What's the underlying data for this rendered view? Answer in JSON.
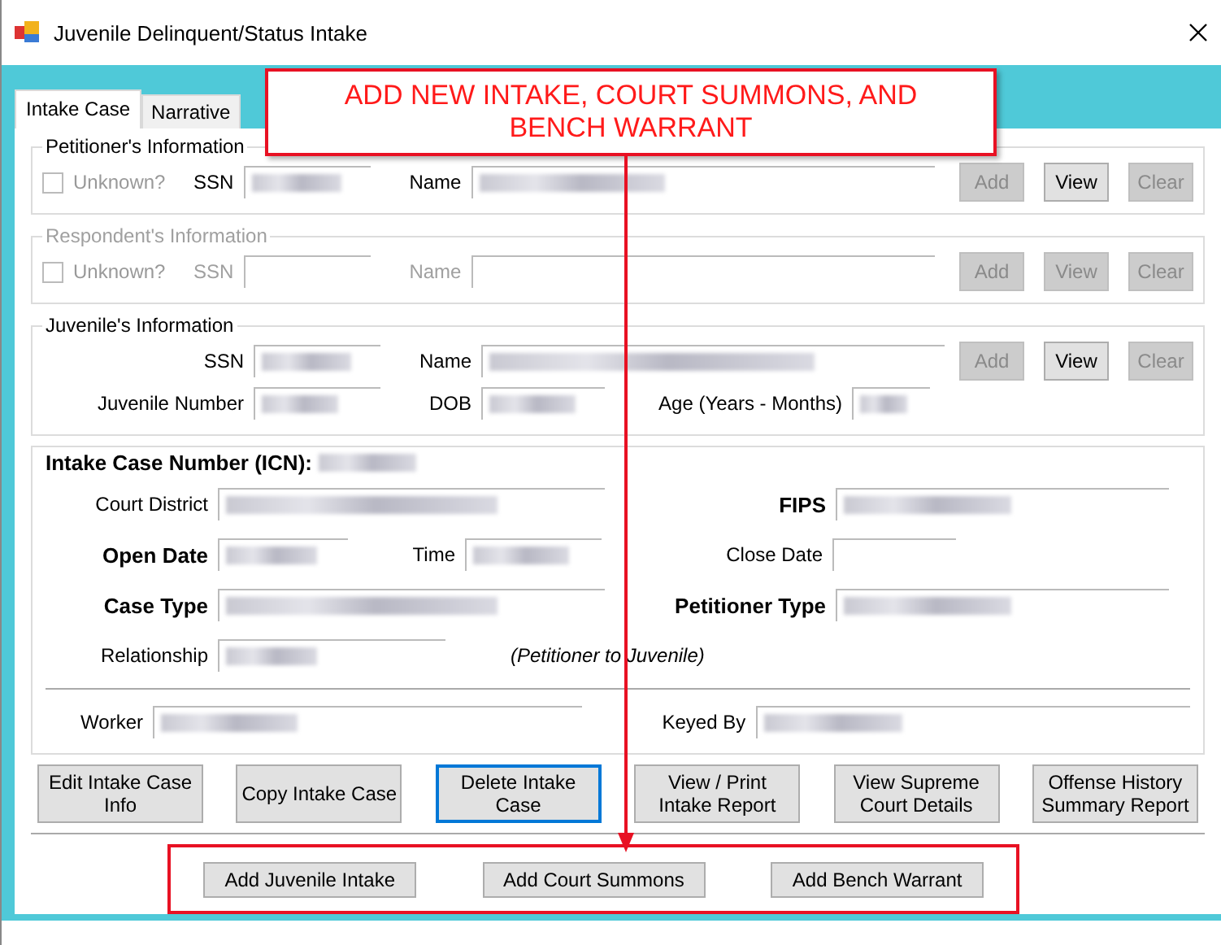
{
  "window": {
    "title": "Juvenile Delinquent/Status Intake"
  },
  "tabs": [
    {
      "label": "Intake Case",
      "selected": true
    },
    {
      "label": "Narrative",
      "selected": false
    }
  ],
  "parties": [
    {
      "title": "Petitioner's Information",
      "disabled": false,
      "unknown": {
        "label": "Unknown?",
        "checked": false
      },
      "ssn_label": "SSN",
      "name_label": "Name",
      "redacted": true,
      "buttons": [
        {
          "label": "Add",
          "disabled": true
        },
        {
          "label": "View",
          "disabled": false
        },
        {
          "label": "Clear",
          "disabled": true
        }
      ]
    },
    {
      "title": "Respondent's Information",
      "disabled": true,
      "unknown": {
        "label": "Unknown?",
        "checked": false
      },
      "ssn_label": "SSN",
      "name_label": "Name",
      "redacted": false,
      "buttons": [
        {
          "label": "Add",
          "disabled": true
        },
        {
          "label": "View",
          "disabled": true
        },
        {
          "label": "Clear",
          "disabled": true
        }
      ]
    }
  ],
  "juvenile": {
    "title": "Juvenile's Information",
    "ssn_label": "SSN",
    "name_label": "Name",
    "number_label": "Juvenile Number",
    "dob_label": "DOB",
    "age_label": "Age (Years - Months)",
    "buttons": [
      {
        "label": "Add",
        "disabled": true
      },
      {
        "label": "View",
        "disabled": false
      },
      {
        "label": "Clear",
        "disabled": true
      }
    ]
  },
  "case": {
    "heading": "Intake Case Number (ICN):",
    "rows": [
      {
        "kind": "pair",
        "left": {
          "label": "Court District",
          "bold": false,
          "redacted": true
        },
        "right": {
          "label": "FIPS",
          "bold": true,
          "redacted": true
        }
      },
      {
        "kind": "date",
        "left": {
          "label": "Open Date",
          "bold": true,
          "redacted": true
        },
        "middle": {
          "label": "Time",
          "bold": false,
          "redacted": true
        },
        "right": {
          "label": "Close Date",
          "bold": false,
          "redacted": false
        }
      },
      {
        "kind": "pair",
        "left": {
          "label": "Case Type",
          "bold": true,
          "redacted": true
        },
        "right": {
          "label": "Petitioner Type",
          "bold": true,
          "redacted": true
        }
      },
      {
        "kind": "note",
        "left": {
          "label": "Relationship",
          "bold": false,
          "redacted": true
        },
        "note": "(Petitioner to Juvenile)"
      }
    ],
    "footer": {
      "left": {
        "label": "Worker",
        "bold": false,
        "redacted": true
      },
      "right": {
        "label": "Keyed By",
        "bold": false,
        "redacted": true
      }
    }
  },
  "actions": [
    {
      "label": "Edit Intake Case Info",
      "focused": false
    },
    {
      "label": "Copy Intake Case",
      "focused": false
    },
    {
      "label": "Delete Intake Case",
      "focused": true
    },
    {
      "label": "View / Print Intake Report",
      "focused": false
    },
    {
      "label": "View Supreme Court Details",
      "focused": false
    },
    {
      "label": "Offense History Summary Report",
      "focused": false
    }
  ],
  "add_buttons": [
    "Add Juvenile Intake",
    "Add Court Summons",
    "Add Bench Warrant"
  ],
  "callout": {
    "text": "ADD NEW INTAKE, COURT SUMMONS, AND BENCH WARRANT"
  }
}
